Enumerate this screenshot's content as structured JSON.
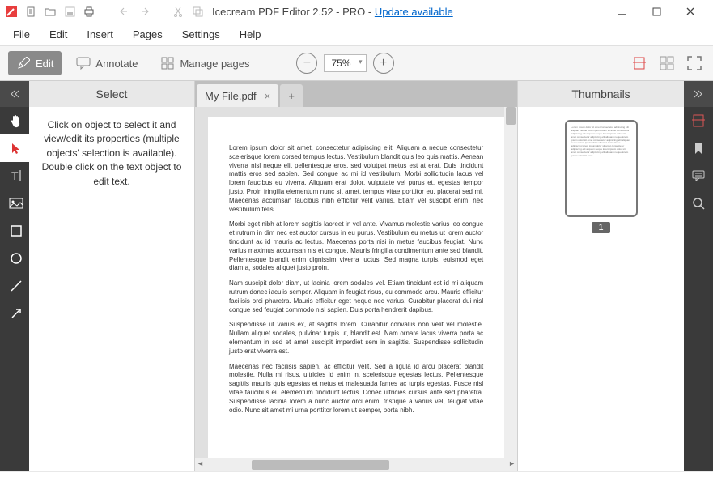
{
  "titlebar": {
    "app_title": "Icecream PDF Editor 2.52 - PRO - ",
    "update_link": "Update available"
  },
  "menu": {
    "file": "File",
    "edit": "Edit",
    "insert": "Insert",
    "pages": "Pages",
    "settings": "Settings",
    "help": "Help"
  },
  "toolbar": {
    "edit": "Edit",
    "annotate": "Annotate",
    "manage_pages": "Manage pages",
    "zoom_value": "75%"
  },
  "select_panel": {
    "title": "Select",
    "body": "Click on object to select it and view/edit its properties (multiple objects' selection is available). Double click on the text object to edit text."
  },
  "tabs": {
    "file_name": "My File.pdf"
  },
  "document": {
    "p1": "Lorem ipsum dolor sit amet, consectetur adipiscing elit. Aliquam a neque consectetur scelerisque lorem corsed tempus lectus. Vestibulum blandit quis leo quis mattis. Aenean viverra nisl neque elit pellentesque eros, sed volutpat metus est at erat. Duis tincidunt mattis eros sed sapien. Sed congue ac mi id vestibulum. Morbi sollicitudin lacus vel lorem faucibus eu viverra. Aliquam erat dolor, vulputate vel purus et, egestas tempor justo. Proin fringilla elementum nunc sit amet, tempus vitae porttitor eu, placerat sed mi. Maecenas accumsan faucibus nibh efficitur velit varius. Etiam vel suscipit enim, nec vestibulum felis.",
    "p2": "Morbi eget nibh at lorem sagittis laoreet in vel ante. Vivamus molestie varius leo congue et rutrum in dim nec est auctor cursus in eu purus. Vestibulum eu metus ut lorem auctor tincidunt ac id mauris ac lectus. Maecenas porta nisi in metus faucibus feugiat. Nunc varius maximus accumsan nis et congue. Mauris fringilla condimentum ante sed blandit. Pellentesque blandit enim dignissim viverra luctus. Sed magna turpis, euismod eget diam a, sodales aliquet justo proin.",
    "p3": "Nam suscipit dolor diam, ut lacinia lorem sodales vel. Etiam tincidunt est id mi aliquam rutrum donec iaculis semper. Aliquam in feugiat risus, eu commodo arcu. Mauris efficitur facilisis orci pharetra. Mauris efficitur eget neque nec varius. Curabitur placerat dui nisl congue sed feugiat commodo nisl sapien. Duis porta hendrerit dapibus.",
    "p4": "Suspendisse ut varius ex, at sagittis lorem. Curabitur convallis non velit vel molestie. Nullam aliquet sodales, pulvinar turpis ut, blandit est. Nam ornare lacus viverra porta ac elementum in sed et amet suscipit imperdiet sem in sagittis. Suspendisse sollicitudin justo erat viverra est.",
    "p5": "Maecenas nec facilisis sapien, ac efficitur velit. Sed a ligula id arcu placerat blandit molestie. Nulla mi risus, ultricies id enim in, scelerisque egestas lectus. Pellentesque sagittis mauris quis egestas et netus et malesuada fames ac turpis egestas. Fusce nisl vitae faucibus eu elementum tincidunt lectus. Donec ultricies cursus ante sed pharetra. Suspendisse lacinia lorem a nunc auctor orci enim, tristique a varius vel, feugiat vitae odio. Nunc sit amet mi urna porttitor lorem ut semper, porta nibh."
  },
  "thumbnails": {
    "title": "Thumbnails",
    "page_num": "1"
  },
  "status": ""
}
